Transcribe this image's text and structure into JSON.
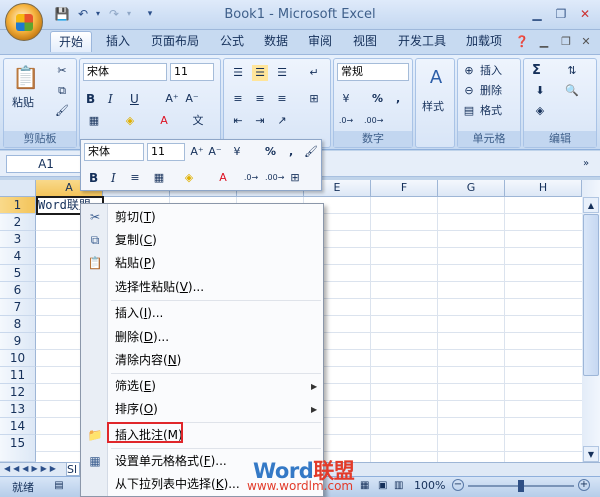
{
  "window": {
    "title": "Book1 - Microsoft Excel"
  },
  "tabs": [
    "开始",
    "插入",
    "页面布局",
    "公式",
    "数据",
    "审阅",
    "视图",
    "开发工具",
    "加载项"
  ],
  "ribbon": {
    "clipboard": {
      "label": "剪贴板",
      "paste": "粘贴"
    },
    "font": {
      "name": "宋体",
      "size": "11",
      "bold": "B",
      "italic": "I",
      "underline": "U"
    },
    "number": {
      "label": "数字",
      "format": "常规",
      "percent": "%",
      "comma": ","
    },
    "styles": {
      "label": "样式"
    },
    "cells": {
      "label": "单元格",
      "insert": "插入",
      "delete": "删除",
      "format": "格式"
    },
    "editing": {
      "label": "编辑",
      "sigma": "Σ"
    }
  },
  "formula_bar": {
    "namebox": "A1"
  },
  "grid": {
    "columns": [
      "A",
      "B",
      "C",
      "D",
      "E",
      "F",
      "G",
      "H"
    ],
    "rows": [
      "1",
      "2",
      "3",
      "4",
      "5",
      "6",
      "7",
      "8",
      "9",
      "10",
      "11",
      "12",
      "13",
      "14",
      "15"
    ],
    "a1_value": "Word联盟"
  },
  "mini_toolbar": {
    "font": "宋体",
    "size": "11",
    "bold": "B",
    "italic": "I",
    "percent": "%",
    "comma": ","
  },
  "context_menu": {
    "items": [
      {
        "text": "剪切(",
        "key": "T",
        "end": ")"
      },
      {
        "text": "复制(",
        "key": "C",
        "end": ")"
      },
      {
        "text": "粘贴(",
        "key": "P",
        "end": ")"
      },
      {
        "text": "选择性粘贴(",
        "key": "V",
        "end": ")..."
      },
      {
        "text": "插入(",
        "key": "I",
        "end": ")..."
      },
      {
        "text": "删除(",
        "key": "D",
        "end": ")..."
      },
      {
        "text": "清除内容(",
        "key": "N",
        "end": ")"
      },
      {
        "text": "筛选(",
        "key": "E",
        "end": ")"
      },
      {
        "text": "排序(",
        "key": "O",
        "end": ")"
      },
      {
        "text": "插入批注(M)"
      },
      {
        "text": "设置单元格格式(",
        "key": "F",
        "end": ")..."
      },
      {
        "text": "从下拉列表中选择(",
        "key": "K",
        "end": ")..."
      }
    ]
  },
  "sheet_tabs": {
    "first": "Sl"
  },
  "status": {
    "ready": "就绪",
    "zoom": "100%"
  },
  "watermark": {
    "word": "Word",
    "lianmeng": "联盟",
    "url": "www.wordlm.com"
  }
}
